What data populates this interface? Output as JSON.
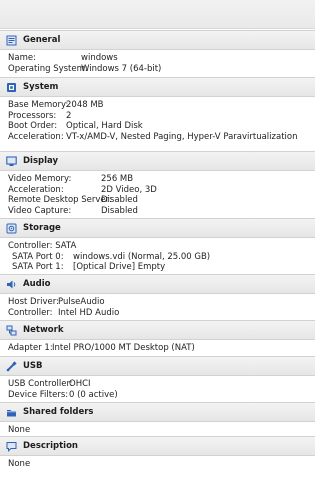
{
  "sections": {
    "general": {
      "title": "General",
      "icon": "general-icon",
      "rows": [
        {
          "label": "Name:",
          "value": "windows"
        },
        {
          "label": "Operating System:",
          "value": "Windows 7 (64-bit)"
        }
      ]
    },
    "system": {
      "title": "System",
      "icon": "chip-icon",
      "rows": [
        {
          "label": "Base Memory:",
          "value": "2048 MB"
        },
        {
          "label": "Processors:",
          "value": "2"
        },
        {
          "label": "Boot Order:",
          "value": "Optical, Hard Disk"
        },
        {
          "label": "Acceleration:",
          "value": "VT-x/AMD-V, Nested Paging, Hyper-V Paravirtualization"
        }
      ]
    },
    "display": {
      "title": "Display",
      "icon": "monitor-icon",
      "rows": [
        {
          "label": "Video Memory:",
          "value": "256 MB"
        },
        {
          "label": "Acceleration:",
          "value": "2D Video, 3D"
        },
        {
          "label": "Remote Desktop Server:",
          "value": "Disabled"
        },
        {
          "label": "Video Capture:",
          "value": "Disabled"
        }
      ]
    },
    "storage": {
      "title": "Storage",
      "icon": "disk-icon",
      "controller": "Controller: SATA",
      "rows": [
        {
          "label": "SATA Port 0:",
          "value": "windows.vdi (Normal, 25.00 GB)"
        },
        {
          "label": "SATA Port 1:",
          "value": "[Optical Drive] Empty"
        }
      ]
    },
    "audio": {
      "title": "Audio",
      "icon": "speaker-icon",
      "rows": [
        {
          "label": "Host Driver:",
          "value": "PulseAudio"
        },
        {
          "label": "Controller:",
          "value": "Intel HD Audio"
        }
      ]
    },
    "network": {
      "title": "Network",
      "icon": "network-icon",
      "rows": [
        {
          "label": "Adapter 1:",
          "value": "Intel PRO/1000 MT Desktop (NAT)"
        }
      ]
    },
    "usb": {
      "title": "USB",
      "icon": "usb-icon",
      "rows": [
        {
          "label": "USB Controller:",
          "value": "OHCI"
        },
        {
          "label": "Device Filters:",
          "value": "0 (0 active)"
        }
      ]
    },
    "shared": {
      "title": "Shared folders",
      "icon": "folder-icon",
      "text": "None"
    },
    "description": {
      "title": "Description",
      "icon": "speech-bubble-icon",
      "text": "None"
    }
  },
  "colors": {
    "icon_blue": "#2f63b8",
    "header_bg": "#e9e9e9",
    "text": "#222222"
  }
}
